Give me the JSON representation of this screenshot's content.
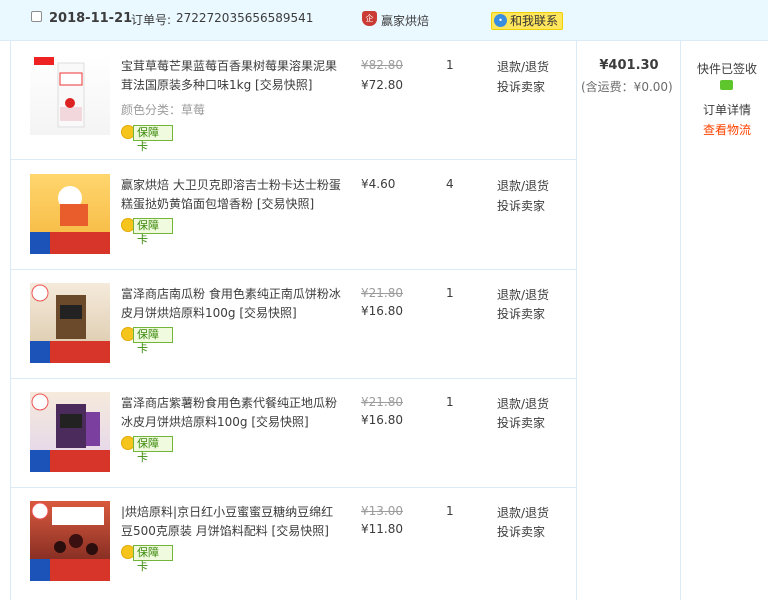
{
  "order": {
    "date": "2018-11-21",
    "order_no_label": "订单号:",
    "order_no": "272272035656589541",
    "shop_name": "赢家烘焙",
    "shop_icon": "企",
    "contact_label": "和我联系",
    "total": "¥401.30",
    "freight": "(含运费：¥0.00)",
    "status": "快件已签收",
    "detail_link": "订单详情",
    "logistics_link": "查看物流"
  },
  "items": [
    {
      "title": "宝茸草莓芒果蓝莓百香果树莓果溶果泥果茸法国原装多种口味1kg [交易快照]",
      "spec": "颜色分类：草莓",
      "old_price": "¥82.80",
      "price": "¥72.80",
      "qty": "1",
      "refund": "退款/退货",
      "complain": "投诉卖家",
      "guard": "保障卡"
    },
    {
      "title": "赢家烘焙 大卫贝克即溶吉士粉卡达士粉蛋糕蛋挞奶黄馅面包增香粉 [交易快照]",
      "spec": "",
      "old_price": "",
      "price": "¥4.60",
      "qty": "4",
      "refund": "退款/退货",
      "complain": "投诉卖家",
      "guard": "保障卡"
    },
    {
      "title": "富泽商店南瓜粉 食用色素纯正南瓜饼粉冰皮月饼烘焙原料100g [交易快照]",
      "spec": "",
      "old_price": "¥21.80",
      "price": "¥16.80",
      "qty": "1",
      "refund": "退款/退货",
      "complain": "投诉卖家",
      "guard": "保障卡"
    },
    {
      "title": "富泽商店紫薯粉食用色素代餐纯正地瓜粉冰皮月饼烘焙原料100g [交易快照]",
      "spec": "",
      "old_price": "¥21.80",
      "price": "¥16.80",
      "qty": "1",
      "refund": "退款/退货",
      "complain": "投诉卖家",
      "guard": "保障卡"
    },
    {
      "title": "|烘焙原料|京日红小豆蜜蜜豆糖纳豆绵红豆500克原装 月饼馅料配料 [交易快照]",
      "spec": "",
      "old_price": "¥13.00",
      "price": "¥11.80",
      "qty": "1",
      "refund": "退款/退货",
      "complain": "投诉卖家",
      "guard": "保障卡"
    }
  ]
}
